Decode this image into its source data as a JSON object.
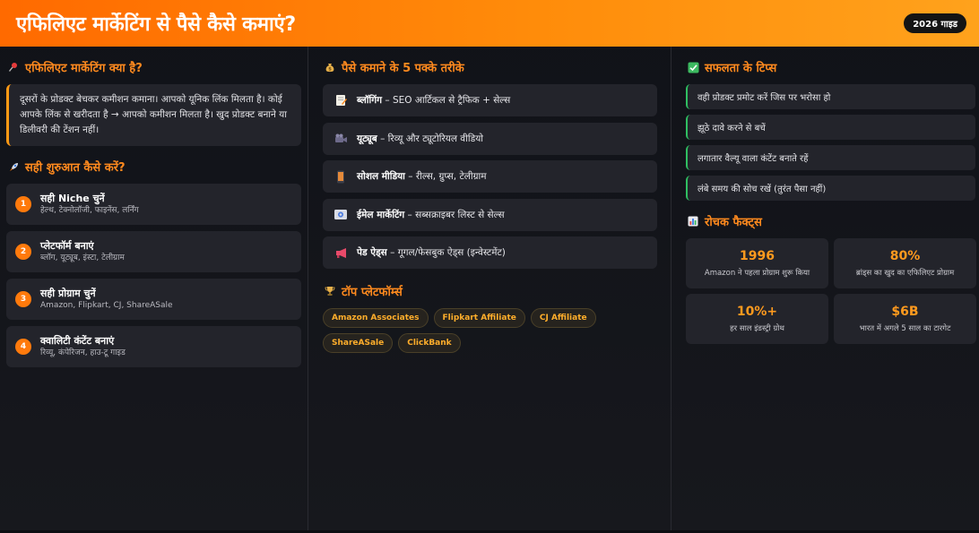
{
  "header": {
    "title": "एफिलिएट मार्केटिंग से पैसे कैसे कमाएं?",
    "badge": "2026 गाइड"
  },
  "intro": {
    "title": "एफिलिएट मार्केटिंग क्या है?",
    "icon": "pushpin-icon",
    "text": "दूसरों के प्रोडक्ट बेचकर कमीशन कमाना। आपको यूनिक लिंक मिलता है। कोई आपके लिंक से खरीदता है → आपको कमीशन मिलता है। खुद प्रोडक्ट बनाने या डिलीवरी की टेंशन नहीं।"
  },
  "start": {
    "title": "सही शुरुआत कैसे करें?",
    "icon": "rocket-icon",
    "steps": [
      {
        "num": "1",
        "title": "सही Niche चुनें",
        "sub": "हेल्थ, टेक्नोलॉजी, फाइनेंस, लर्निंग"
      },
      {
        "num": "2",
        "title": "प्लेटफॉर्म बनाएं",
        "sub": "ब्लॉग, यूट्यूब, इंस्टा, टेलीग्राम"
      },
      {
        "num": "3",
        "title": "सही प्रोग्राम चुनें",
        "sub": "Amazon, Flipkart, CJ, ShareASale"
      },
      {
        "num": "4",
        "title": "क्वालिटी कंटेंट बनाएं",
        "sub": "रिव्यू, कंपेरिजन, हाउ-टू गाइड"
      }
    ]
  },
  "methods": {
    "title": "पैसे कमाने के 5 पक्के तरीके",
    "icon": "money-bag-icon",
    "items": [
      {
        "icon": "memo-icon",
        "bold": "ब्लॉगिंग",
        "text": " – SEO आर्टिकल से ट्रैफिक + सेल्स"
      },
      {
        "icon": "video-camera-icon",
        "bold": "यूट्यूब",
        "text": " – रिव्यू और ट्यूटोरियल वीडियो"
      },
      {
        "icon": "mobile-phone-icon",
        "bold": "सोशल मीडिया",
        "text": " – रील्स, ग्रुप्स, टेलीग्राम"
      },
      {
        "icon": "email-icon",
        "bold": "ईमेल मार्केटिंग",
        "text": " – सब्सक्राइबर लिस्ट से सेल्स"
      },
      {
        "icon": "megaphone-icon",
        "bold": "पेड ऐड्स",
        "text": " – गूगल/फेसबुक ऐड्स (इन्वेस्टमेंट)"
      }
    ]
  },
  "platforms": {
    "title": "टॉप प्लेटफॉर्म्स",
    "icon": "trophy-icon",
    "items": [
      "Amazon Associates",
      "Flipkart Affiliate",
      "CJ Affiliate",
      "ShareASale",
      "ClickBank"
    ]
  },
  "tips": {
    "title": "सफलता के टिप्स",
    "icon": "check-mark-icon",
    "items": [
      "वही प्रोडक्ट प्रमोट करें जिस पर भरोसा हो",
      "झूठे दावे करने से बचें",
      "लगातार वैल्यू वाला कंटेंट बनाते रहें",
      "लंबे समय की सोच रखें (तुरंत पैसा नहीं)"
    ]
  },
  "facts": {
    "title": "रोचक फैक्ट्स",
    "icon": "bar-chart-icon",
    "items": [
      {
        "value": "1996",
        "label": "Amazon ने पहला प्रोग्राम शुरू किया"
      },
      {
        "value": "80%",
        "label": "ब्रांड्स का खुद का एफिलिएट प्रोग्राम"
      },
      {
        "value": "10%+",
        "label": "हर साल इंडस्ट्री ग्रोथ"
      },
      {
        "value": "$6B",
        "label": "भारत में अगले 5 साल का टारगेट"
      }
    ]
  },
  "colors": {
    "accent": "#ff8a1e",
    "header_start": "#ff6a00",
    "header_end": "#ffa21c",
    "tip_border": "#2fbf62",
    "card_bg": "#23242b"
  }
}
